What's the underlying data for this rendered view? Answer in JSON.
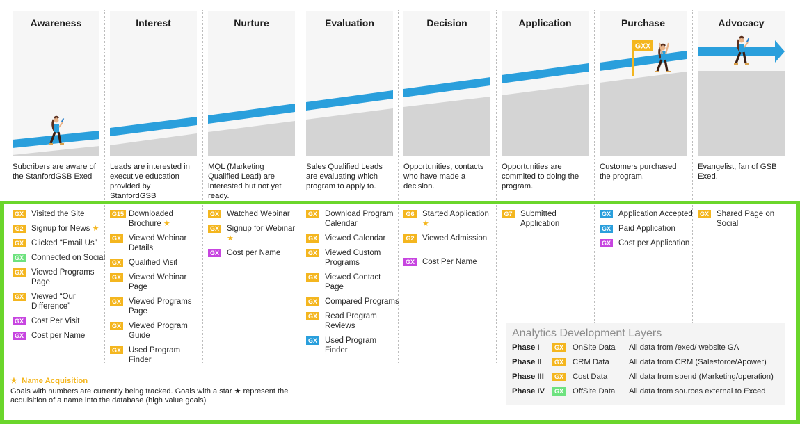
{
  "colors": {
    "frame_green": "#6bd62b",
    "path_blue": "#2a9fdc",
    "ground_gray": "#d4d4d4",
    "panel_bg": "#f6f6f6",
    "badge_orange": "#f4b61f",
    "badge_green": "#6ee27f",
    "badge_purple": "#c745e0",
    "badge_blue": "#2a9fdc"
  },
  "stages": [
    {
      "title": "Awareness",
      "description": "Subcribers are aware of the StanfordGSB Exed",
      "goals": [
        {
          "badge": "GX",
          "color": "orange",
          "label": "Visited the Site",
          "star": false
        },
        {
          "badge": "G2",
          "color": "orange",
          "label": "Signup for News",
          "star": true
        },
        {
          "badge": "GX",
          "color": "orange",
          "label": "Clicked “Email Us”",
          "star": false
        },
        {
          "badge": "GX",
          "color": "green",
          "label": "Connected on Social",
          "star": false
        },
        {
          "badge": "GX",
          "color": "orange",
          "label": "Viewed Programs Page",
          "star": false
        },
        {
          "badge": "GX",
          "color": "orange",
          "label": "Viewed “Our Difference”",
          "star": false
        },
        {
          "badge": "GX",
          "color": "purple",
          "label": "Cost Per Visit",
          "star": false
        },
        {
          "badge": "GX",
          "color": "purple",
          "label": "Cost per Name",
          "star": false
        }
      ]
    },
    {
      "title": "Interest",
      "description": "Leads are interested in executive education provided by StanfordGSB",
      "goals": [
        {
          "badge": "G15",
          "color": "orange",
          "label": "Downloaded Brochure",
          "star": true
        },
        {
          "badge": "GX",
          "color": "orange",
          "label": "Viewed Webinar Details",
          "star": false
        },
        {
          "badge": "GX",
          "color": "orange",
          "label": "Qualified Visit",
          "star": false
        },
        {
          "badge": "GX",
          "color": "orange",
          "label": "Viewed Webinar Page",
          "star": false
        },
        {
          "badge": "GX",
          "color": "orange",
          "label": "Viewed Programs Page",
          "star": false
        },
        {
          "badge": "GX",
          "color": "orange",
          "label": "Viewed Program Guide",
          "star": false
        },
        {
          "badge": "GX",
          "color": "orange",
          "label": "Used Program Finder",
          "star": false
        }
      ]
    },
    {
      "title": "Nurture",
      "description": "MQL (Marketing Qualified Lead) are interested but not yet ready.",
      "goals": [
        {
          "badge": "GX",
          "color": "orange",
          "label": "Watched Webinar",
          "star": false
        },
        {
          "badge": "GX",
          "color": "orange",
          "label": "Signup for Webinar",
          "star": true
        },
        {
          "badge": "GX",
          "color": "purple",
          "label": "Cost per Name",
          "star": false
        }
      ]
    },
    {
      "title": "Evaluation",
      "description": "Sales Qualified Leads are evaluating which program to apply to.",
      "goals": [
        {
          "badge": "GX",
          "color": "orange",
          "label": "Download Program Calendar",
          "star": false
        },
        {
          "badge": "GX",
          "color": "orange",
          "label": "Viewed Calendar",
          "star": false
        },
        {
          "badge": "GX",
          "color": "orange",
          "label": "Viewed Custom Programs",
          "star": false
        },
        {
          "badge": "GX",
          "color": "orange",
          "label": "Viewed Contact Page",
          "star": false
        },
        {
          "badge": "GX",
          "color": "orange",
          "label": "Compared Programs",
          "star": false
        },
        {
          "badge": "GX",
          "color": "orange",
          "label": "Read Program Reviews",
          "star": false
        },
        {
          "badge": "GX",
          "color": "blue",
          "label": "Used Program Finder",
          "star": false
        }
      ]
    },
    {
      "title": "Decision",
      "description": "Opportunities, contacts who have made a decision.",
      "goals": [
        {
          "badge": "G6",
          "color": "orange",
          "label": "Started Application",
          "star": true
        },
        {
          "badge": "G2",
          "color": "orange",
          "label": "Viewed Admission",
          "star": false
        },
        {
          "badge": "GX",
          "color": "purple",
          "label": "Cost Per Name",
          "star": false
        }
      ]
    },
    {
      "title": "Application",
      "description": "Opportunities are commited to doing the program.",
      "goals": [
        {
          "badge": "G7",
          "color": "orange",
          "label": "Submitted Application",
          "star": false
        }
      ]
    },
    {
      "title": "Purchase",
      "description": "Customers purchased the program.",
      "flag_label": "GXX",
      "goals": [
        {
          "badge": "GX",
          "color": "blue",
          "label": "Application Accepted",
          "star": false
        },
        {
          "badge": "GX",
          "color": "blue",
          "label": "Paid Application",
          "star": false
        },
        {
          "badge": "GX",
          "color": "purple",
          "label": "Cost per Application",
          "star": false
        }
      ]
    },
    {
      "title": "Advocacy",
      "description": "Evangelist, fan of GSB Exed.",
      "goals": [
        {
          "badge": "GX",
          "color": "orange",
          "label": "Shared Page on Social",
          "star": false
        }
      ]
    }
  ],
  "legend": {
    "title": "Analytics Development Layers",
    "rows": [
      {
        "phase": "Phase I",
        "badge": "GX",
        "color": "orange",
        "type": "OnSite Data",
        "description": "All data from /exed/ website GA"
      },
      {
        "phase": "Phase II",
        "badge": "GX",
        "color": "orange",
        "type": "CRM Data",
        "description": "All data from CRM (Salesforce/Apower)"
      },
      {
        "phase": "Phase III",
        "badge": "GX",
        "color": "orange",
        "type": "Cost Data",
        "description": "All data from spend (Marketing/operation)"
      },
      {
        "phase": "Phase IV",
        "badge": "GX",
        "color": "green",
        "type": "OffSite Data",
        "description": "All data from sources external to Exced"
      }
    ]
  },
  "note": {
    "star_icon": "★",
    "title": "Name Acquisition",
    "text": "Goals with numbers are currently being tracked. Goals with a star ★ represent the acquisition of a name into the database (high value goals)"
  }
}
